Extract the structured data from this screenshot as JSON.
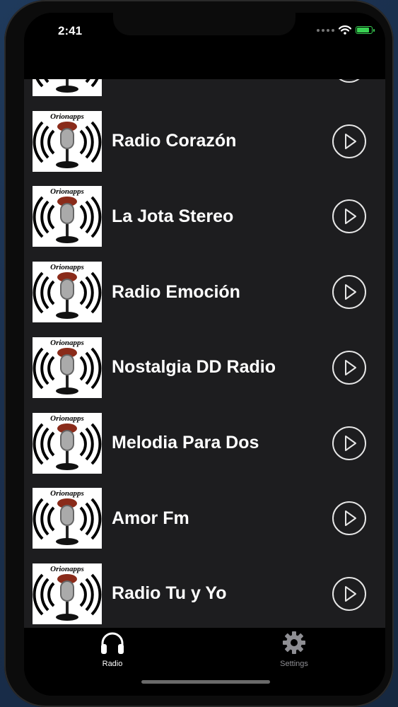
{
  "status_bar": {
    "time": "2:41",
    "battery_color": "#39d153"
  },
  "thumbnail_brand": "Orionapps",
  "stations": [
    {
      "name": ""
    },
    {
      "name": "Radio Corazón"
    },
    {
      "name": "La Jota Stereo"
    },
    {
      "name": "Radio Emoción"
    },
    {
      "name": "Nostalgia DD Radio"
    },
    {
      "name": "Melodia Para Dos"
    },
    {
      "name": "Amor Fm"
    },
    {
      "name": "Radio Tu y Yo"
    }
  ],
  "icons": {
    "play": "play-circle-icon",
    "radio_tab": "headphones-icon",
    "settings_tab": "gear-icon"
  },
  "tabbar": {
    "radio_label": "Radio",
    "settings_label": "Settings",
    "active_color": "#ffffff",
    "inactive_color": "#8e8e93"
  }
}
